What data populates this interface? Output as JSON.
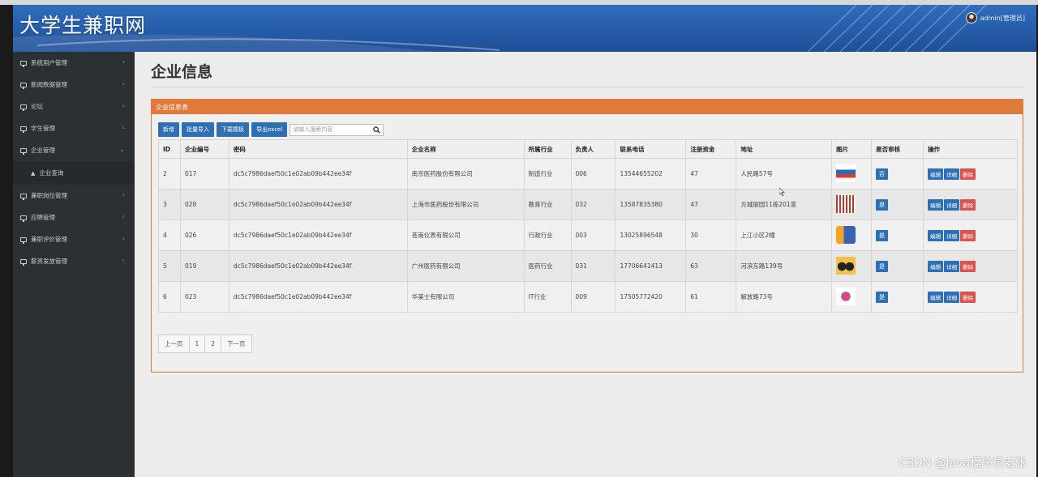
{
  "app": {
    "title": "大学生兼职网",
    "user": "admin[管理员]"
  },
  "sidebar": {
    "items": [
      {
        "label": "系统用户管理",
        "arrow": "‹"
      },
      {
        "label": "新闻数据管理",
        "arrow": "‹"
      },
      {
        "label": "论坛",
        "arrow": "‹"
      },
      {
        "label": "学生管理",
        "arrow": "‹"
      },
      {
        "label": "企业管理",
        "arrow": "⌄"
      },
      {
        "label": "兼职岗位管理",
        "arrow": "‹"
      },
      {
        "label": "应聘管理",
        "arrow": "‹"
      },
      {
        "label": "兼职评价管理",
        "arrow": "‹"
      },
      {
        "label": "薪资发放管理",
        "arrow": "‹"
      }
    ],
    "sub_item": "企业查询"
  },
  "page": {
    "title": "企业信息",
    "panel_title": "企业信息表"
  },
  "toolbar": {
    "add": "新增",
    "batch_import": "批量导入",
    "download_template": "下载模板",
    "export_excel": "导出excel",
    "search_placeholder": "请输入搜索内容"
  },
  "table": {
    "columns": [
      "ID",
      "企业编号",
      "密码",
      "企业名称",
      "所属行业",
      "负责人",
      "联系电话",
      "注册资金",
      "地址",
      "图片",
      "是否审核",
      "操作"
    ],
    "rows": [
      {
        "id": "2",
        "code": "017",
        "password": "dc5c7986daef50c1e02ab09b442ee34f",
        "name": "南京医药股份有限公司",
        "industry": "制造行业",
        "manager": "006",
        "phone": "13544655202",
        "capital": "47",
        "address": "人民路57号",
        "audit": "否"
      },
      {
        "id": "3",
        "code": "028",
        "password": "dc5c7986daef50c1e02ab09b442ee34f",
        "name": "上海市医药股份有限公司",
        "industry": "教育行业",
        "manager": "032",
        "phone": "13587835380",
        "capital": "47",
        "address": "方城丽园11栋201室",
        "audit": "是"
      },
      {
        "id": "4",
        "code": "026",
        "password": "dc5c7986daef50c1e02ab09b442ee34f",
        "name": "苍南仪表有限公司",
        "industry": "行政行业",
        "manager": "003",
        "phone": "13025896548",
        "capital": "30",
        "address": "上江小区2幢",
        "audit": "是"
      },
      {
        "id": "5",
        "code": "019",
        "password": "dc5c7986daef50c1e02ab09b442ee34f",
        "name": "广州医药有限公司",
        "industry": "医药行业",
        "manager": "031",
        "phone": "17706641413",
        "capital": "63",
        "address": "河滨东路139号",
        "audit": "是"
      },
      {
        "id": "6",
        "code": "023",
        "password": "dc5c7986daef50c1e02ab09b442ee34f",
        "name": "华莱士有限公司",
        "industry": "IT行业",
        "manager": "009",
        "phone": "17505772420",
        "capital": "61",
        "address": "解放路73号",
        "audit": "是"
      }
    ],
    "actions": {
      "edit": "编辑",
      "detail": "详细",
      "delete": "删除"
    }
  },
  "pager": {
    "prev": "上一页",
    "page1": "1",
    "page2": "2",
    "next": "下一页"
  },
  "watermark": "CSDN @Java程序员老张",
  "colors": {
    "header": "#2f6dbd",
    "sidebar": "#2b3033",
    "panel_accent": "#e07a3a",
    "button": "#2f6fb3",
    "danger": "#d9534f"
  }
}
